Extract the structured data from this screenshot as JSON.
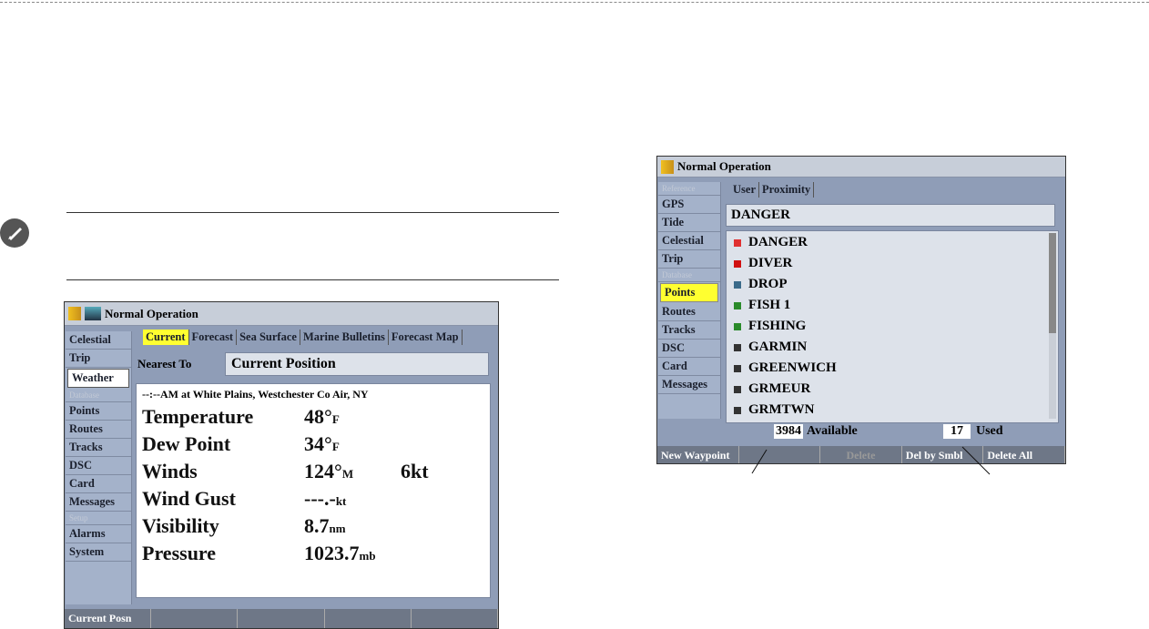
{
  "weather_screen": {
    "title": "Normal Operation",
    "sidebar": [
      {
        "label": "Celestial",
        "type": "item"
      },
      {
        "label": "Trip",
        "type": "item"
      },
      {
        "label": "Weather",
        "type": "selected"
      },
      {
        "label": "Database",
        "type": "cat"
      },
      {
        "label": "Points",
        "type": "item"
      },
      {
        "label": "Routes",
        "type": "item"
      },
      {
        "label": "Tracks",
        "type": "item"
      },
      {
        "label": "DSC",
        "type": "item"
      },
      {
        "label": "Card",
        "type": "item"
      },
      {
        "label": "Messages",
        "type": "item"
      },
      {
        "label": "Setup",
        "type": "cat"
      },
      {
        "label": "Alarms",
        "type": "item"
      },
      {
        "label": "System",
        "type": "item"
      }
    ],
    "tabs": [
      "Current",
      "Forecast",
      "Sea Surface",
      "Marine Bulletins",
      "Forecast Map"
    ],
    "nearest_label": "Nearest To",
    "nearest_value": "Current Position",
    "station": "--:--AM at White Plains, Westchester Co Air, NY",
    "rows": [
      {
        "label": "Temperature",
        "value": "48°",
        "unit": "F",
        "extra": ""
      },
      {
        "label": "Dew Point",
        "value": "34°",
        "unit": "F",
        "extra": ""
      },
      {
        "label": "Winds",
        "value": "124°",
        "unit": "M",
        "extra": "6kt"
      },
      {
        "label": "Wind Gust",
        "value": "---.-",
        "unit": "kt",
        "extra": ""
      },
      {
        "label": "Visibility",
        "value": "8.7",
        "unit": "nm",
        "extra": ""
      },
      {
        "label": "Pressure",
        "value": "1023.7",
        "unit": "mb",
        "extra": ""
      }
    ],
    "buttons": [
      "Current Posn",
      "",
      "",
      "",
      ""
    ]
  },
  "points_screen": {
    "title": "Normal Operation",
    "sidebar": [
      {
        "label": "Reference",
        "type": "cat"
      },
      {
        "label": "GPS",
        "type": "item"
      },
      {
        "label": "Tide",
        "type": "item"
      },
      {
        "label": "Celestial",
        "type": "item"
      },
      {
        "label": "Trip",
        "type": "item"
      },
      {
        "label": "Database",
        "type": "cat"
      },
      {
        "label": "Points",
        "type": "selected"
      },
      {
        "label": "Routes",
        "type": "item"
      },
      {
        "label": "Tracks",
        "type": "item"
      },
      {
        "label": "DSC",
        "type": "item"
      },
      {
        "label": "Card",
        "type": "item"
      },
      {
        "label": "Messages",
        "type": "item"
      }
    ],
    "tabs": [
      "User",
      "Proximity"
    ],
    "search_value": "DANGER",
    "waypoints": [
      {
        "name": "DANGER",
        "color": "#e03030"
      },
      {
        "name": "DIVER",
        "color": "#d01010"
      },
      {
        "name": "DROP",
        "color": "#3a6a8a"
      },
      {
        "name": "FISH 1",
        "color": "#2a8a2a"
      },
      {
        "name": "FISHING",
        "color": "#2a8a2a"
      },
      {
        "name": "GARMIN",
        "color": "#333333"
      },
      {
        "name": "GREENWICH",
        "color": "#333333"
      },
      {
        "name": "GRMEUR",
        "color": "#333333"
      },
      {
        "name": "GRMTWN",
        "color": "#333333"
      }
    ],
    "available_count": "3984",
    "available_label": "Available",
    "used_count": "17",
    "used_label": "Used",
    "buttons": [
      "New Waypoint",
      "",
      "Delete",
      "Del by Smbl",
      "Delete All"
    ]
  }
}
